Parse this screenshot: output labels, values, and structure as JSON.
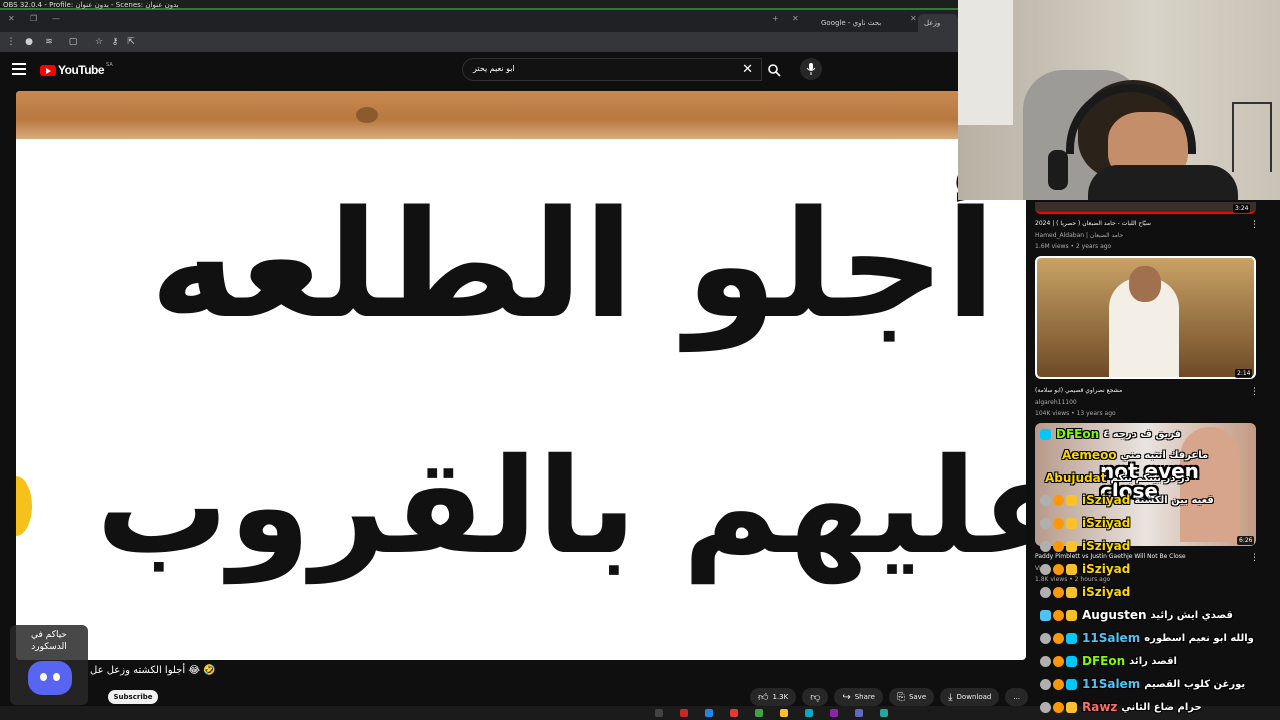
{
  "obs": {
    "title": "OBS 32.0.4 - Profile: بدون عنوان - Scenes: بدون عنوان"
  },
  "browser": {
    "tabs": [
      {
        "label": "Google - بحث ناوي الخلود"
      },
      {
        "label": "وزعل علي..."
      }
    ],
    "new_tab": "+"
  },
  "youtube": {
    "logo_text": "YouTube",
    "region": "SA",
    "search_query": "ابو نعيم يحتر",
    "video": {
      "line1": "أجلو الطلعه",
      "line2": "ل عليهم بالقروب"
    },
    "video_title": "🤣 😂 أجلوا الكشته وزعل عل",
    "subscribe_label": "Subscribe",
    "actions": {
      "likes": "1.3K",
      "share": "Share",
      "save": "Save",
      "download": "Download",
      "more": "..."
    }
  },
  "discord_overlay": {
    "text": "حياكم في الدسكورد"
  },
  "sidebar": {
    "items": [
      {
        "duration": "3:24",
        "title": "سيّاح اللبات - حامد الضبعان ( حصرياً ) | 2024",
        "channel": "Hamed_Aldaban | حامد الضبعان",
        "meta": "1.6M views • 2 years ago"
      },
      {
        "duration": "2:14",
        "title": "مشجع نصراوي قصيمي (ابو سلامة)",
        "channel": "algareh11100",
        "meta": "104K views • 13 years ago"
      },
      {
        "duration": "6:26",
        "title": "Paddy Pimblett vs Justin Gaethje Will Not Be Close",
        "channel": "Vic...",
        "meta": "1.8K views • 2 hours ago",
        "overlay": "not even close"
      }
    ]
  },
  "chat": [
    {
      "name": "DFEon",
      "color": "#7cfc00",
      "msg": "فريق ف درجه ٤"
    },
    {
      "name": "Aemeoo",
      "color": "#ffd700",
      "msg": "ماعرفك انتبه مني"
    },
    {
      "name": "Abujudat",
      "color": "#ffd700",
      "msg": "در در بيتكم بتكم"
    },
    {
      "name": "iSziyad",
      "color": "#ffd700",
      "msg": "قعيه بين الكشتة"
    },
    {
      "name": "iSziyad",
      "color": "#ffd700",
      "msg": ""
    },
    {
      "name": "iSziyad",
      "color": "#ffd700",
      "msg": ""
    },
    {
      "name": "iSziyad",
      "color": "#ffd700",
      "msg": ""
    },
    {
      "name": "iSziyad",
      "color": "#ffd700",
      "msg": ""
    },
    {
      "name": "Augusten",
      "color": "#ffffff",
      "msg": "قصدي ايش رائيد"
    },
    {
      "name": "11Salem",
      "color": "#4fc3f7",
      "msg": "والله ابو نعيم اسطوره"
    },
    {
      "name": "DFEon",
      "color": "#7cfc00",
      "msg": "اقصد رائد"
    },
    {
      "name": "11Salem",
      "color": "#4fc3f7",
      "msg": "يورغن كلوب القصيم"
    },
    {
      "name": "Rawz",
      "color": "#ff6b6b",
      "msg": "حرام ضاع الثاني"
    }
  ]
}
